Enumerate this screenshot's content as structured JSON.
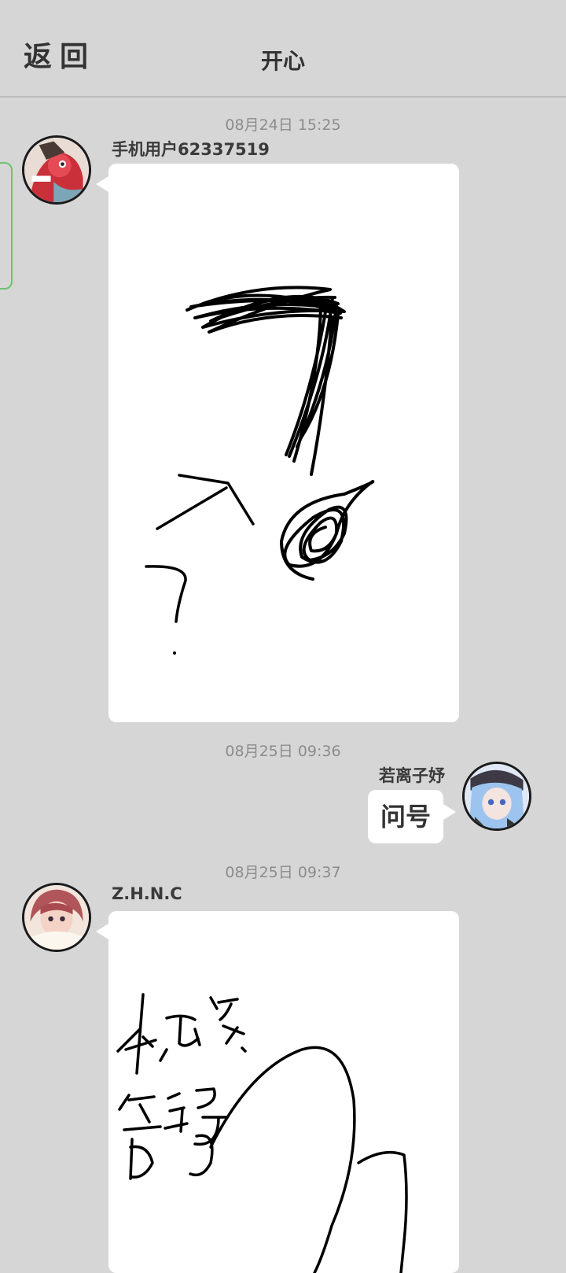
{
  "header": {
    "back_label": "返回",
    "title": "开心"
  },
  "messages": [
    {
      "time": "08月24日  15:25",
      "sender": "手机用户62337519",
      "type": "drawing"
    },
    {
      "time": "08月25日  09:36",
      "sender": "若离子妤",
      "type": "text",
      "text": "问号"
    },
    {
      "time": "08月25日  09:37",
      "sender": "Z.H.N.C",
      "type": "drawing"
    }
  ],
  "icons": {
    "back": "back-icon",
    "avatar1": "avatar-image",
    "avatar2": "avatar-image",
    "avatar3": "avatar-image"
  }
}
